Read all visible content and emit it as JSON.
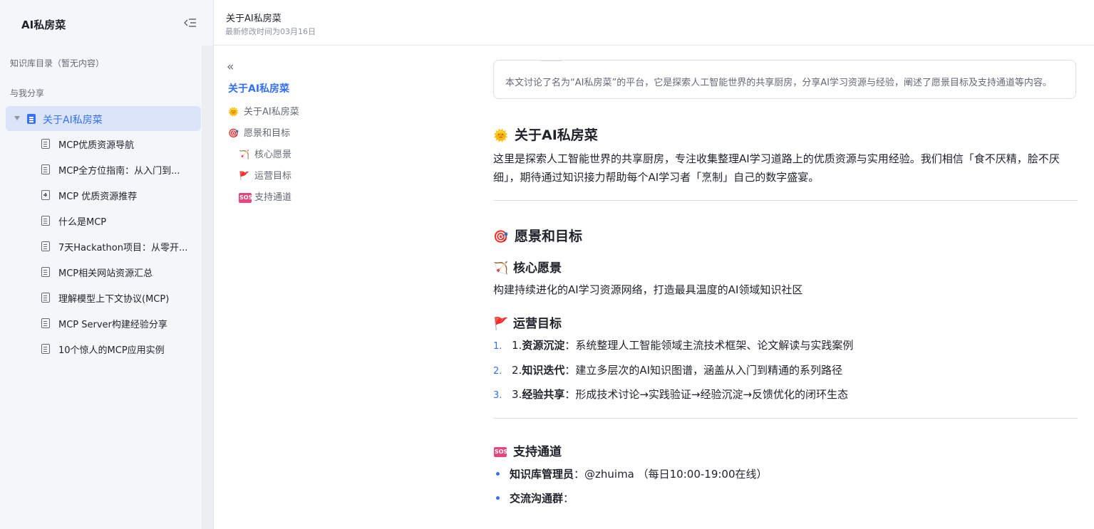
{
  "sidebar": {
    "title": "AI私房菜",
    "kb_dir_label": "知识库目录（暂无内容）",
    "shared_label": "与我分享",
    "root_label": "关于AI私房菜",
    "items": [
      {
        "label": "MCP优质资源导航",
        "icon": "doc"
      },
      {
        "label": "MCP全方位指南：从入门到...",
        "icon": "doc"
      },
      {
        "label": "MCP 优质资源推荐",
        "icon": "doc-plus"
      },
      {
        "label": "什么是MCP",
        "icon": "doc"
      },
      {
        "label": "7天Hackathon项目：从零开...",
        "icon": "doc"
      },
      {
        "label": "MCP相关网站资源汇总",
        "icon": "doc"
      },
      {
        "label": "理解模型上下文协议(MCP)",
        "icon": "doc"
      },
      {
        "label": "MCP Server构建经验分享",
        "icon": "doc"
      },
      {
        "label": "10个惊人的MCP应用实例",
        "icon": "doc"
      }
    ]
  },
  "header": {
    "title": "关于AI私房菜",
    "modified": "最新修改时间为03月16日"
  },
  "toc": {
    "title": "关于AI私房菜",
    "items": [
      {
        "icon": "sun-icon",
        "glyph": "🌞",
        "label": "关于AI私房菜"
      },
      {
        "icon": "target-icon",
        "glyph": "🎯",
        "label": "愿景和目标"
      },
      {
        "icon": "bow-arrow-icon",
        "glyph": "🏹",
        "label": "核心愿景"
      },
      {
        "icon": "flag-icon",
        "glyph": "🚩",
        "label": "运营目标"
      },
      {
        "icon": "sos-icon",
        "glyph": "SOS",
        "label": "支持通道"
      }
    ]
  },
  "content": {
    "summary": "本文讨论了名为“AI私房菜”的平台，它是探索人工智能世界的共享厨房，分享AI学习资源与经验，阐述了愿景目标及支持通道等内容。",
    "s1_title": "关于AI私房菜",
    "s1_body": "这里是探索人工智能世界的共享厨房，专注收集整理AI学习道路上的优质资源与实用经验。我们相信「食不厌精，脍不厌细」，期待通过知识接力帮助每个AI学习者「烹制」自己的数字盛宴。",
    "s2_title": "愿景和目标",
    "s2a_title": "核心愿景",
    "s2a_body": "构建持续进化的AI学习资源网络，打造最具温度的AI领域知识社区",
    "s2b_title": "运营目标",
    "goals": [
      {
        "num": "1.",
        "prefix": "1.",
        "bold": "资源沉淀",
        "text": "：系统整理人工智能领域主流技术框架、论文解读与实践案例"
      },
      {
        "num": "2.",
        "prefix": "2.",
        "bold": "知识迭代",
        "text": "：建立多层次的AI知识图谱，涵盖从入门到精通的系列路径"
      },
      {
        "num": "3.",
        "prefix": "3.",
        "bold": "经验共享",
        "text": "：形成技术讨论→实践验证→经验沉淀→反馈优化的闭环生态"
      }
    ],
    "s3_title": "支持通道",
    "support": [
      {
        "bold": "知识库管理员",
        "text": "：@zhuima （每日10:00-19:00在线）"
      },
      {
        "bold": "交流沟通群",
        "text": "："
      }
    ]
  },
  "colors": {
    "accent": "#3370ff",
    "selected_bg": "#dbe4f9",
    "sidebar_bg": "#f4f6f9"
  }
}
